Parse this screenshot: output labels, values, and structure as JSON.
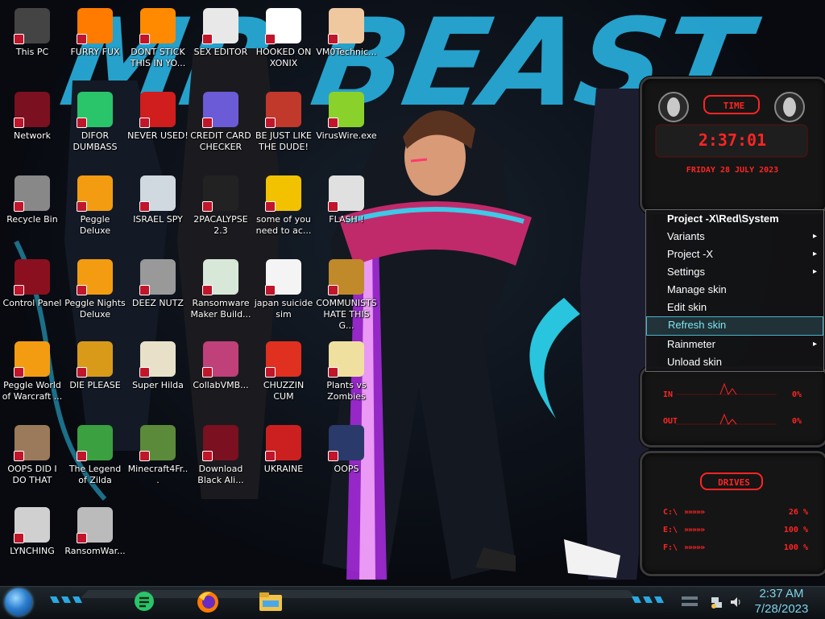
{
  "wallpaper": {
    "title": "MR BEAST"
  },
  "desktop_icons": [
    {
      "label": "This PC",
      "icon": "pc-icon",
      "color": "#444"
    },
    {
      "label": "FURRY FUX",
      "icon": "firefox-icon",
      "color": "#ff7b00"
    },
    {
      "label": "DONT STICK THIS IN YO...",
      "icon": "vlc-cone-icon",
      "color": "#ff8a00"
    },
    {
      "label": "SEX EDITOR",
      "icon": "hxd-icon",
      "color": "#e8e8e8"
    },
    {
      "label": "HOOKED ON XONIX",
      "icon": "xonix-icon",
      "color": "#ffffff"
    },
    {
      "label": "VM0Technic...",
      "icon": "doctor-icon",
      "color": "#f0c8a0"
    },
    {
      "label": "Network",
      "icon": "alien-network-icon",
      "color": "#7a1020"
    },
    {
      "label": "DIFOR DUMBASS",
      "icon": "chat-icon",
      "color": "#2ac46a"
    },
    {
      "label": "NEVER USED!",
      "icon": "dev-icon",
      "color": "#d01d1d"
    },
    {
      "label": "CREDIT CARD CHECKER",
      "icon": "credit-card-icon",
      "color": "#6b5bd6"
    },
    {
      "label": "BE JUST LIKE THE DUDE!",
      "icon": "santa-icon",
      "color": "#c0392b"
    },
    {
      "label": "VirusWire.exe",
      "icon": "lime-icon",
      "color": "#8bd12b"
    },
    {
      "label": "Recycle Bin",
      "icon": "recycle-bin-icon",
      "color": "#888"
    },
    {
      "label": "Peggle Deluxe",
      "icon": "peggle-icon",
      "color": "#f39c12"
    },
    {
      "label": "ISRAEL SPY",
      "icon": "folder-icon",
      "color": "#d0d8e0"
    },
    {
      "label": "2PACALYPSE 2.3",
      "icon": "terminal-icon",
      "color": "#222"
    },
    {
      "label": "some of you need to ac...",
      "icon": "beaver-icon",
      "color": "#f2c200"
    },
    {
      "label": "FLASH !",
      "icon": "flash-doc-icon",
      "color": "#e0e0e0"
    },
    {
      "label": "Control Panel",
      "icon": "control-panel-icon",
      "color": "#8a1020"
    },
    {
      "label": "Peggle Nights Deluxe",
      "icon": "peggle-icon",
      "color": "#f39c12"
    },
    {
      "label": "DEEZ NUTZ",
      "icon": "stack-icon",
      "color": "#999"
    },
    {
      "label": "Ransomware Maker Build...",
      "icon": "window-icon",
      "color": "#d8e8d8"
    },
    {
      "label": "japan suicide sim",
      "icon": "doc-icon",
      "color": "#f4f4f4"
    },
    {
      "label": "COMMUNISTS HATE THIS G...",
      "icon": "money-bag-icon",
      "color": "#c08a2a"
    },
    {
      "label": "Peggle World of Warcraft ...",
      "icon": "peggle-icon",
      "color": "#f39c12"
    },
    {
      "label": "DIE PLEASE",
      "icon": "director-icon",
      "color": "#d99a1a"
    },
    {
      "label": "Super Hilda",
      "icon": "pixel-dog-icon",
      "color": "#e8e0c8"
    },
    {
      "label": "CollabVMB...",
      "icon": "collab-icon",
      "color": "#c0407a"
    },
    {
      "label": "CHUZZIN CUM",
      "icon": "chuzzle-icon",
      "color": "#e03020"
    },
    {
      "label": "Plants vs Zombies",
      "icon": "flower-icon",
      "color": "#f0e0a0"
    },
    {
      "label": "OOPS DID I DO THAT",
      "icon": "portrait-icon",
      "color": "#9a7a5a"
    },
    {
      "label": "The Legend of Zilda",
      "icon": "zelda-icon",
      "color": "#3aa040"
    },
    {
      "label": "Minecraft4Fr...",
      "icon": "grass-block-icon",
      "color": "#5a8a3a"
    },
    {
      "label": "Download Black Ali...",
      "icon": "alien-icon",
      "color": "#7a1020"
    },
    {
      "label": "UKRAINE",
      "icon": "radiation-icon",
      "color": "#cc2020"
    },
    {
      "label": "OOPS",
      "icon": "monitor-icon",
      "color": "#2a3a6a"
    },
    {
      "label": "LYNCHING",
      "icon": "noose-icon",
      "color": "#d0d0d0"
    },
    {
      "label": "RansomWar...",
      "icon": "skull-icon",
      "color": "#bbbbbb"
    }
  ],
  "clock_gadget": {
    "heading": "TIME",
    "time": "2:37:01",
    "date": "FRIDAY 28 JULY 2023"
  },
  "network_gadget": {
    "in_label": "IN",
    "in_value": "0%",
    "out_label": "OUT",
    "out_value": "0%"
  },
  "drives_gadget": {
    "heading": "DRIVES",
    "drives": [
      {
        "letter": "C:\\",
        "value": "26 %"
      },
      {
        "letter": "E:\\",
        "value": "100 %"
      },
      {
        "letter": "F:\\",
        "value": "100 %"
      }
    ]
  },
  "context_menu": {
    "title": "Project -X\\Red\\System",
    "items": [
      {
        "label": "Variants",
        "submenu": true
      },
      {
        "label": "Project -X",
        "submenu": true
      },
      {
        "label": "Settings",
        "submenu": true
      },
      {
        "label": "Manage skin",
        "submenu": false
      },
      {
        "label": "Edit skin",
        "submenu": false
      },
      {
        "label": "Refresh skin",
        "submenu": false,
        "selected": true
      },
      {
        "label": "Rainmeter",
        "submenu": true
      },
      {
        "label": "Unload skin",
        "submenu": false
      }
    ]
  },
  "taskbar": {
    "apps": [
      {
        "name": "chat-app",
        "icon": "chat-icon",
        "color": "#2ac46a"
      },
      {
        "name": "firefox",
        "icon": "firefox-icon",
        "color": "#ff7b00"
      },
      {
        "name": "file-explorer",
        "icon": "folder-icon",
        "color": "#f3c34a"
      }
    ],
    "tray_icons": [
      "network-tray-icon",
      "volume-icon"
    ],
    "time": "2:37 AM",
    "date": "7/28/2023"
  },
  "colors": {
    "accent": "#27a9d6",
    "gadget_red": "#ff2424",
    "menu_highlight": "#4bb3c8"
  }
}
